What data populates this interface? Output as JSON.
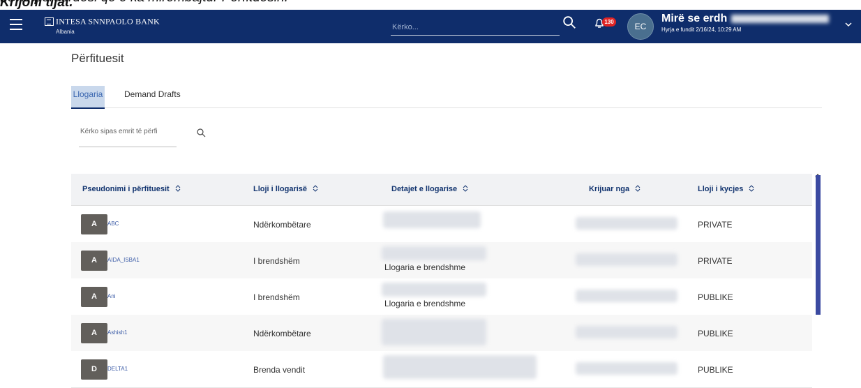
{
  "top_strip": {
    "prefix": "Krijoni tijat.",
    "text": " Lëviz përdoruesi që e ka mirëmbajtur Përfituesin."
  },
  "app": {
    "brand_name": "INTESA SNNPAOLO BANK",
    "brand_sub": "Albania"
  },
  "header": {
    "search_placeholder": "Kërko...",
    "notifications_count": "130",
    "avatar_initials": "EC",
    "welcome_text": "Mirë se erdh",
    "last_login": "Hyrja e fundit 2/16/24, 10:29 AM"
  },
  "page": {
    "title": "Përfituesit"
  },
  "tabs": [
    {
      "label": "Llogaria"
    },
    {
      "label": "Demand Drafts"
    }
  ],
  "filter": {
    "placeholder": "Kërko sipas emrit të përfi"
  },
  "table": {
    "headers": [
      "Pseudonimi i përfituesit",
      "Lloji i llogarisë",
      "Detajet e llogarise",
      "Krijuar nga",
      "Lloji i kycjes"
    ],
    "rows": [
      {
        "initial": "A",
        "name": "ABC",
        "type": "Ndërkombëtare",
        "details": "",
        "access": "PRIVATE"
      },
      {
        "initial": "A",
        "name": "AIDA_ISBA1",
        "type": "I brendshëm",
        "details": "Llogaria e brendshme",
        "access": "PRIVATE"
      },
      {
        "initial": "A",
        "name": "Ani",
        "type": "I brendshëm",
        "details": "Llogaria e brendshme",
        "access": "PUBLIKE"
      },
      {
        "initial": "A",
        "name": "Ashish1",
        "type": "Ndërkombëtare",
        "details": "",
        "access": "PUBLIKE"
      },
      {
        "initial": "D",
        "name": "DELTA1",
        "type": "Brenda vendit",
        "details": "",
        "access": "PUBLIKE"
      }
    ]
  },
  "colors": {
    "navbar": "#0f2d6b",
    "accent": "#12346f",
    "badge": "#e02424",
    "scrollbar": "#3b4aa1"
  },
  "icons": [
    "menu-icon",
    "search-icon",
    "bell-icon",
    "chevron-down-icon",
    "sort-icon"
  ]
}
